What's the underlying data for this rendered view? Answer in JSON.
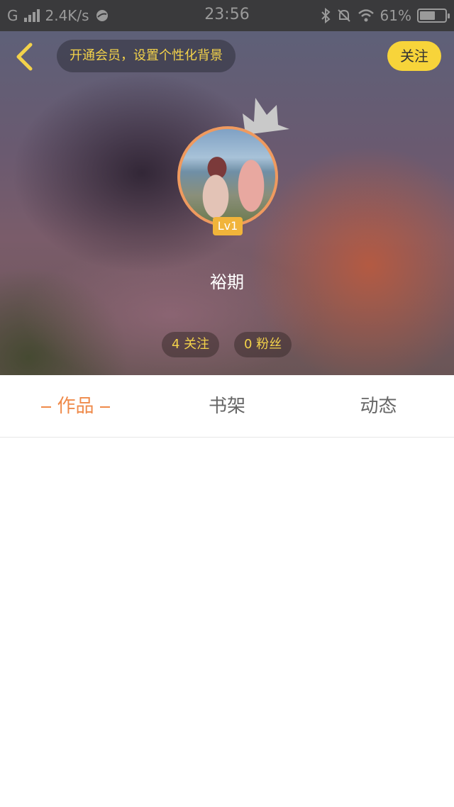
{
  "status_bar": {
    "carrier": "G",
    "net_speed": "2.4K/s",
    "time": "23:56",
    "battery_text": "61%",
    "battery_level": 0.61
  },
  "header": {
    "vip_prompt": "开通会员，设置个性化背景",
    "follow_label": "关注"
  },
  "profile": {
    "level": "Lv1",
    "username": "裕期",
    "following": "4 关注",
    "fans": "0 粉丝"
  },
  "tabs": [
    {
      "label": "作品",
      "active": true
    },
    {
      "label": "书架",
      "active": false
    },
    {
      "label": "动态",
      "active": false
    }
  ],
  "colors": {
    "accent": "#ef8a4a",
    "yellow": "#f7d43a",
    "badge": "#f1b43a"
  }
}
